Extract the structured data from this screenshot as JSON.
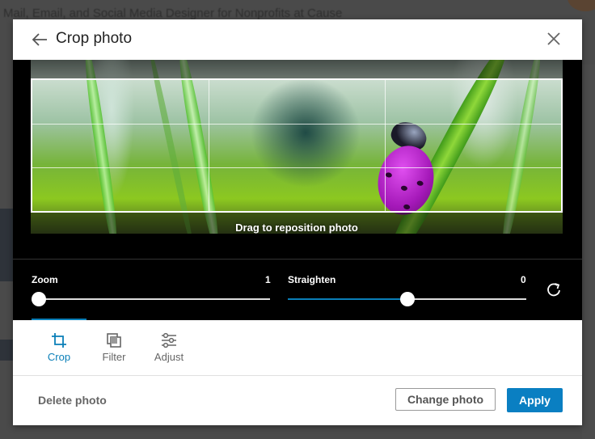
{
  "background": {
    "headline_text": "Mail, Email, and Social Media Designer for Nonprofits at Cause"
  },
  "modal": {
    "title": "Crop photo",
    "back_icon": "arrow-left-icon",
    "close_icon": "close-icon"
  },
  "stage": {
    "drag_hint": "Drag to reposition photo"
  },
  "controls": {
    "zoom": {
      "label": "Zoom",
      "value": "1",
      "fraction": 0.0
    },
    "straighten": {
      "label": "Straighten",
      "value": "0",
      "fraction": 0.5
    },
    "rotate_icon": "rotate-clockwise-icon"
  },
  "tabs": [
    {
      "label": "Crop",
      "icon": "crop-icon",
      "active": true
    },
    {
      "label": "Filter",
      "icon": "filter-icon",
      "active": false
    },
    {
      "label": "Adjust",
      "icon": "sliders-icon",
      "active": false
    }
  ],
  "footer": {
    "delete_label": "Delete photo",
    "change_label": "Change photo",
    "apply_label": "Apply"
  },
  "colors": {
    "accent": "#0a7fc2",
    "stage_bg": "#000000",
    "overlay_bg": "#4a4a4a"
  }
}
